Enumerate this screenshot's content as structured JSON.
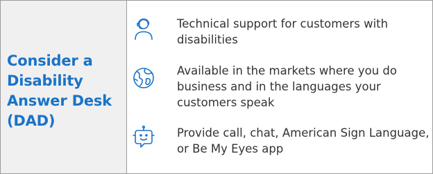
{
  "panel": {
    "title": "Consider a Disability Answer Desk (DAD)"
  },
  "items": [
    {
      "icon": "headset-person-icon",
      "text": "Technical support for customers with disabilities"
    },
    {
      "icon": "globe-icon",
      "text": "Available in the markets where you do business and in the languages your customers speak"
    },
    {
      "icon": "chat-bot-icon",
      "text": "Provide call, chat, American Sign Language, or Be My Eyes app"
    }
  ],
  "colors": {
    "accent": "#1a73c8",
    "left_panel_bg": "#f0f0f0",
    "border": "#9a9a9a",
    "body_text": "#333333"
  }
}
